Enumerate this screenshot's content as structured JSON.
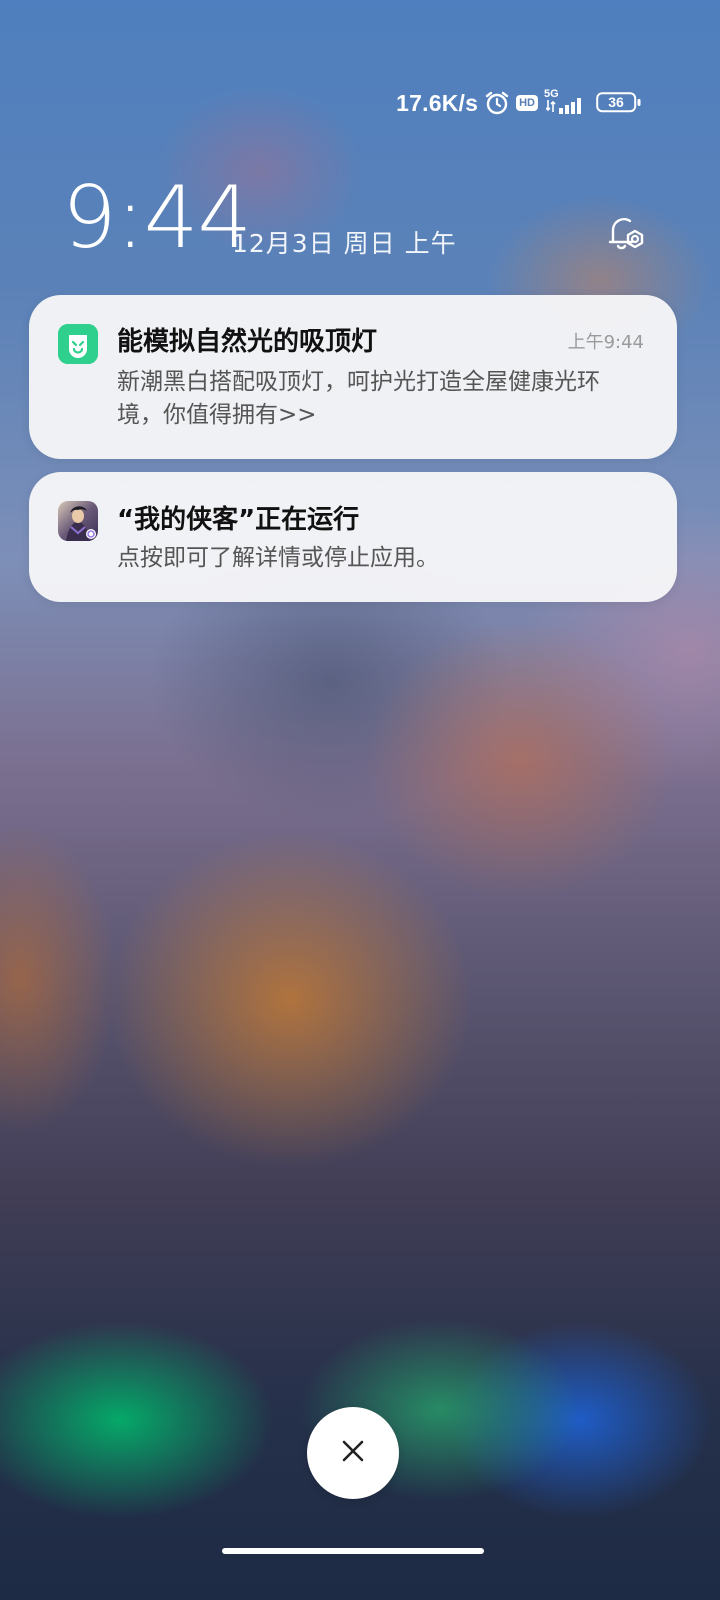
{
  "status_bar": {
    "net_speed": "17.6K/s",
    "alarm_icon": "alarm-clock-icon",
    "hd_badge": "HD",
    "signal_type": "5G",
    "signal_icon": "signal-bars-icon",
    "battery_level": "36"
  },
  "lockscreen": {
    "time": "9:44",
    "date": "12月3日 周日 上午",
    "settings_icon": "notification-settings-icon"
  },
  "notifications": [
    {
      "app_icon": "mijia-app-icon",
      "title": "能模拟自然光的吸顶灯",
      "time": "上午9:44",
      "body": "新潮黑白搭配吸顶灯，呵护光打造全屋健康光环境，你值得拥有>>"
    },
    {
      "app_icon": "game-app-icon",
      "title": "“我的侠客”正在运行",
      "body": "点按即可了解详情或停止应用。"
    }
  ],
  "bottom": {
    "clear_icon": "close-icon"
  },
  "colors": {
    "mijia_green": "#2fcf8e",
    "card_bg": "#f6f6f8"
  }
}
